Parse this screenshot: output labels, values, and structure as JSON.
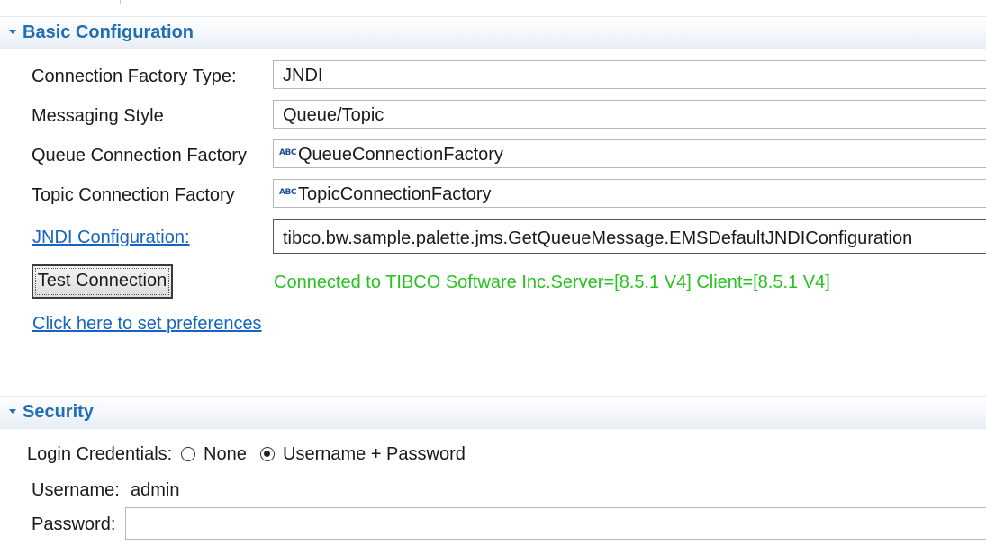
{
  "basic_section": {
    "title": "Basic Configuration"
  },
  "fields": {
    "cf_type": {
      "label": "Connection Factory Type:",
      "value": "JNDI"
    },
    "messaging_style": {
      "label": "Messaging Style",
      "value": "Queue/Topic"
    },
    "queue_cf": {
      "label": "Queue Connection Factory",
      "icon": "abc-string-icon",
      "value": "QueueConnectionFactory"
    },
    "topic_cf": {
      "label": "Topic Connection Factory",
      "icon": "abc-string-icon",
      "value": "TopicConnectionFactory"
    },
    "jndi_config": {
      "label": "JNDI Configuration:",
      "value": "tibco.bw.sample.palette.jms.GetQueueMessage.EMSDefaultJNDIConfiguration"
    }
  },
  "test": {
    "button_label": "Test Connection",
    "status": "Connected to TIBCO Software Inc.Server=[8.5.1 V4] Client=[8.5.1 V4]",
    "status_color": "#27c21f"
  },
  "preferences_link": "Click here to set preferences",
  "security_section": {
    "title": "Security"
  },
  "security": {
    "login_label": "Login Credentials:",
    "options": [
      {
        "label": "None",
        "selected": false
      },
      {
        "label": "Username + Password",
        "selected": true
      }
    ],
    "username_label": "Username:",
    "username_value": "admin",
    "password_label": "Password:",
    "password_value": ""
  },
  "colors": {
    "section_title": "#1f6fb5",
    "link": "#1565c0"
  }
}
